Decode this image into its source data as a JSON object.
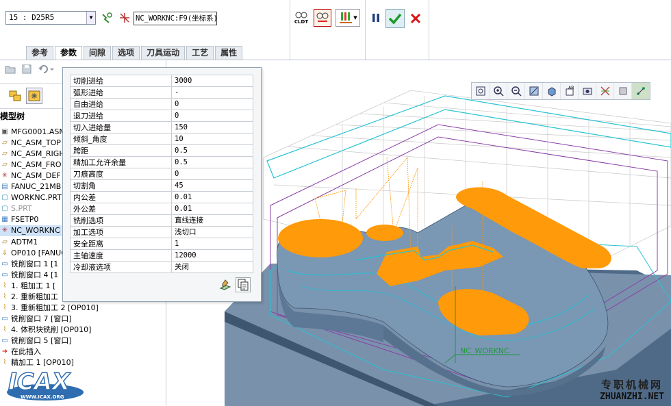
{
  "toolbar": {
    "tool_selector": "15 : D25R5",
    "coord_field": "NC_WORKNC:F9(坐标系)",
    "cldt_label": "CLDT",
    "icons": [
      "tool-select-icon",
      "coordinate-system-icon",
      "cldt-display-icon",
      "toolpath-verify-icon",
      "material-removal-icon",
      "pause-icon",
      "confirm-check-icon",
      "cancel-x-icon"
    ]
  },
  "tabs": [
    "参考",
    "参数",
    "间隙",
    "选项",
    "刀具运动",
    "工艺",
    "属性"
  ],
  "active_tab": "参数",
  "left_toolbar_icons": [
    "open-folder-icon",
    "save-icon",
    "undo-icon"
  ],
  "panel_icons": [
    "model-tree-tab-icon",
    "layer-tree-tab-icon"
  ],
  "model_tree": {
    "title": "模型树",
    "items": [
      {
        "label": "MFG0001.ASM",
        "icon": "assembly-icon"
      },
      {
        "label": "NC_ASM_TOP",
        "icon": "datum-plane-icon"
      },
      {
        "label": "NC_ASM_RIGH",
        "icon": "datum-plane-icon"
      },
      {
        "label": "NC_ASM_FRO",
        "icon": "datum-plane-icon"
      },
      {
        "label": "NC_ASM_DEF",
        "icon": "datum-csys-icon"
      },
      {
        "label": "FANUC_21MB",
        "icon": "machine-icon"
      },
      {
        "label": "WORKNC.PRT",
        "icon": "part-icon"
      },
      {
        "label": "S.PRT",
        "icon": "part-icon"
      },
      {
        "label": "FSETP0",
        "icon": "fixture-icon"
      },
      {
        "label": "NC_WORKNC",
        "icon": "datum-csys-icon"
      },
      {
        "label": "ADTM1",
        "icon": "datum-plane-icon"
      },
      {
        "label": "OP010 [FANUC",
        "icon": "operation-icon"
      },
      {
        "label": "铣削窗口 1 [1",
        "icon": "mill-window-icon"
      },
      {
        "label": "铣削窗口 4 [1",
        "icon": "mill-window-icon"
      },
      {
        "label": "1. 粗加工 1 [",
        "icon": "roughing-icon"
      },
      {
        "label": "2. 重新粗加工",
        "icon": "reroughing-icon"
      },
      {
        "label": "3. 重新粗加工 2 [OP010]",
        "icon": "reroughing-icon"
      },
      {
        "label": "铣削窗口 7 [窗口]",
        "icon": "mill-window-icon"
      },
      {
        "label": "4. 体积块铣削 [OP010]",
        "icon": "volume-mill-icon"
      },
      {
        "label": "铣削窗口 5 [窗口]",
        "icon": "mill-window-icon"
      },
      {
        "label": "在此插入",
        "icon": "insert-here-arrow-icon"
      },
      {
        "label": "精加工 1 [OP010]",
        "icon": "finishing-icon"
      }
    ]
  },
  "params": {
    "rows": [
      {
        "name": "切削进给",
        "value": "3000"
      },
      {
        "name": "弧形进给",
        "value": "-"
      },
      {
        "name": "自由进给",
        "value": "0"
      },
      {
        "name": "退刀进给",
        "value": "0"
      },
      {
        "name": "切入进给量",
        "value": "150"
      },
      {
        "name": "倾斜_角度",
        "value": "10"
      },
      {
        "name": "跨距",
        "value": "0.5"
      },
      {
        "name": "精加工允许余量",
        "value": "0.5"
      },
      {
        "name": "刀痕高度",
        "value": "0"
      },
      {
        "name": "切割角",
        "value": "45"
      },
      {
        "name": "内公差",
        "value": "0.01"
      },
      {
        "name": "外公差",
        "value": "0.01"
      },
      {
        "name": "铣削选项",
        "value": "直线连接"
      },
      {
        "name": "加工选项",
        "value": "浅切口"
      },
      {
        "name": "安全距离",
        "value": "1"
      },
      {
        "name": "主轴速度",
        "value": "12000"
      },
      {
        "name": "冷却液选项",
        "value": "关闭"
      }
    ],
    "buttons": [
      "edit-params-icon",
      "copy-params-icon"
    ]
  },
  "view_toolbar_icons": [
    "refit-icon",
    "zoom-in-icon",
    "zoom-out-icon",
    "repaint-icon",
    "display-style-icon",
    "saved-views-icon",
    "named-view-icon",
    "datum-display-icon",
    "spin-center-icon",
    "toolpath-display-icon"
  ],
  "viewport": {
    "csys_label": "NC_WORKNC",
    "colors": {
      "model": "#7f9cb8",
      "model_dark": "#4e6a86",
      "toolpath": "#ff9a0a",
      "outline": "#27c3d4",
      "purple": "#8a3fa8"
    }
  },
  "logo": {
    "text": "ICAX",
    "url_text": "WWW.ICAX.ORG"
  },
  "watermark": {
    "cn": "专职机械网",
    "en": "ZHUANZHI.NET"
  }
}
